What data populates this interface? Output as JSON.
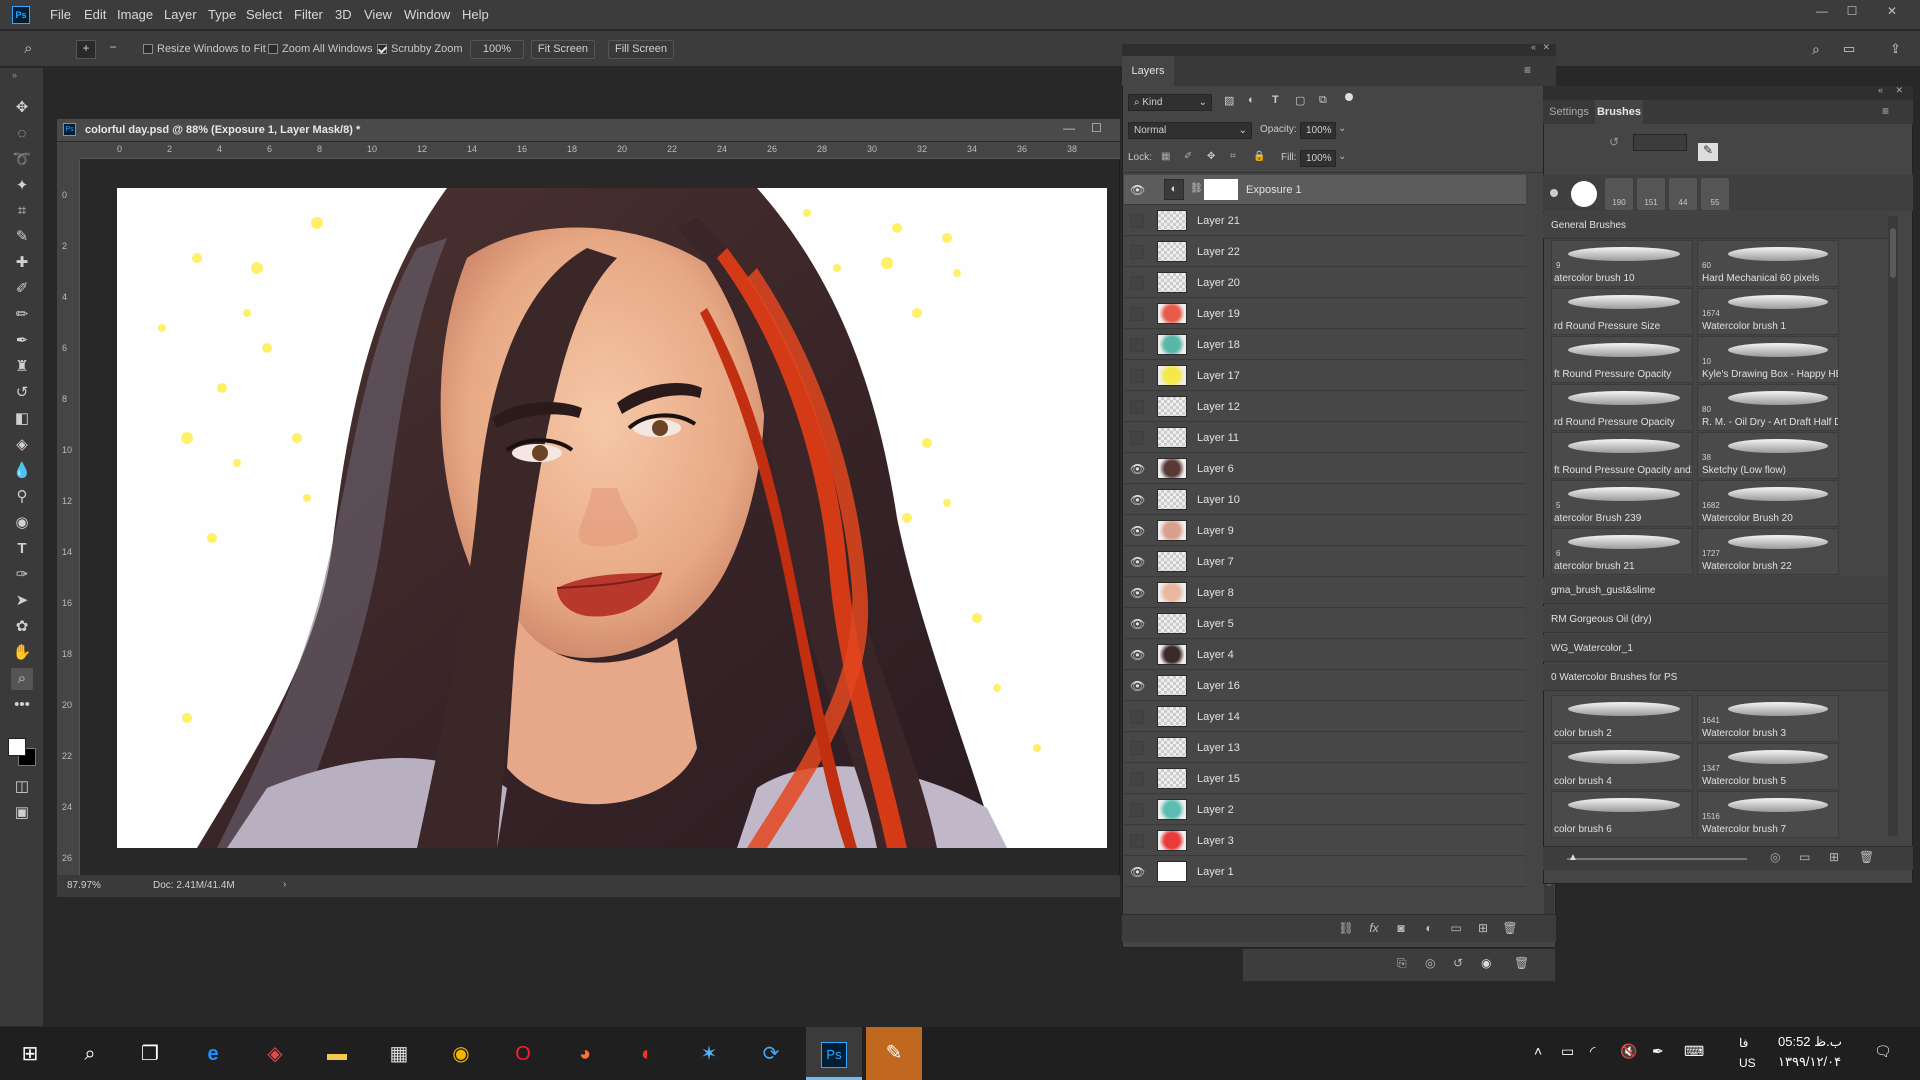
{
  "app": {
    "logo": "Ps"
  },
  "menu": [
    "File",
    "Edit",
    "Image",
    "Layer",
    "Type",
    "Select",
    "Filter",
    "3D",
    "View",
    "Window",
    "Help"
  ],
  "options": {
    "resize_windows": "Resize Windows to Fit",
    "zoom_all": "Zoom All Windows",
    "scrubby_zoom": "Scrubby Zoom",
    "zoom_value": "100%",
    "fit_screen": "Fit Screen",
    "fill_screen": "Fill Screen"
  },
  "document": {
    "title": "colorful day.psd @ 88% (Exposure 1, Layer Mask/8) *",
    "ruler_h": [
      "0",
      "2",
      "4",
      "6",
      "8",
      "10",
      "12",
      "14",
      "16",
      "18",
      "20",
      "22",
      "24",
      "26",
      "28",
      "30",
      "32",
      "34",
      "36",
      "38"
    ],
    "ruler_v": [
      "0",
      "2",
      "4",
      "6",
      "8",
      "10",
      "12",
      "14",
      "16",
      "18",
      "20",
      "22",
      "24",
      "26"
    ],
    "zoom_status": "87.97%",
    "doc_status": "Doc: 2.41M/41.4M"
  },
  "layers_panel": {
    "tab": "Layers",
    "kind": "Kind",
    "blend_mode": "Normal",
    "opacity_label": "Opacity:",
    "opacity": "100%",
    "lock_label": "Lock:",
    "fill_label": "Fill:",
    "fill": "100%",
    "layers": [
      {
        "name": "Exposure 1",
        "visible": true,
        "selected": true
      },
      {
        "name": "Layer 21",
        "visible": false
      },
      {
        "name": "Layer 22",
        "visible": false
      },
      {
        "name": "Layer 20",
        "visible": false
      },
      {
        "name": "Layer 19",
        "visible": false
      },
      {
        "name": "Layer 18",
        "visible": false
      },
      {
        "name": "Layer 17",
        "visible": false
      },
      {
        "name": "Layer 12",
        "visible": false
      },
      {
        "name": "Layer 11",
        "visible": false
      },
      {
        "name": "Layer 6",
        "visible": true
      },
      {
        "name": "Layer 10",
        "visible": true
      },
      {
        "name": "Layer 9",
        "visible": true
      },
      {
        "name": "Layer 7",
        "visible": true
      },
      {
        "name": "Layer 8",
        "visible": true
      },
      {
        "name": "Layer 5",
        "visible": true
      },
      {
        "name": "Layer 4",
        "visible": true
      },
      {
        "name": "Layer 16",
        "visible": true
      },
      {
        "name": "Layer 14",
        "visible": false
      },
      {
        "name": "Layer 13",
        "visible": false
      },
      {
        "name": "Layer 15",
        "visible": false
      },
      {
        "name": "Layer 2",
        "visible": false
      },
      {
        "name": "Layer 3",
        "visible": false
      },
      {
        "name": "Layer 1",
        "visible": true
      }
    ]
  },
  "brushes_panel": {
    "tab_settings": "Settings",
    "tab_brushes": "Brushes",
    "presets": [
      "190",
      "151",
      "44",
      "55"
    ],
    "general_group": "General Brushes",
    "grid": [
      {
        "name": "atercolor brush 10",
        "size": "9"
      },
      {
        "name": "Hard Mechanical 60 pixels",
        "size": "60"
      },
      {
        "name": "rd Round Pressure Size",
        "size": ""
      },
      {
        "name": "Watercolor brush 1",
        "size": "1674"
      },
      {
        "name": "ft Round Pressure Opacity",
        "size": ""
      },
      {
        "name": "Kyle's Drawing Box - Happy HB",
        "size": "10"
      },
      {
        "name": "rd Round Pressure Opacity",
        "size": ""
      },
      {
        "name": "R. M. - Oil Dry - Art Draft Half Dr...",
        "size": "80"
      },
      {
        "name": "ft Round Pressure Opacity and...",
        "size": ""
      },
      {
        "name": "Sketchy (Low flow)",
        "size": "38"
      },
      {
        "name": "atercolor Brush 239",
        "size": "5"
      },
      {
        "name": "Watercolor Brush 20",
        "size": "1682"
      },
      {
        "name": "atercolor brush 21",
        "size": "6"
      },
      {
        "name": "Watercolor brush 22",
        "size": "1727"
      }
    ],
    "groups": [
      "gma_brush_gust&slime",
      "RM Gorgeous Oil (dry)",
      "WG_Watercolor_1",
      "0 Watercolor Brushes for PS"
    ],
    "grid2": [
      {
        "name": "color brush 2",
        "size": ""
      },
      {
        "name": "Watercolor brush 3",
        "size": "1641"
      },
      {
        "name": "color brush 4",
        "size": ""
      },
      {
        "name": "Watercolor brush 5",
        "size": "1347"
      },
      {
        "name": "color brush 6",
        "size": ""
      },
      {
        "name": "Watercolor brush 7",
        "size": "1516"
      }
    ]
  },
  "taskbar": {
    "time": "05:52 ب.ظ",
    "date": "۱۳۹۹/۱۲/۰۴",
    "lang1": "فا",
    "lang2": "US"
  }
}
